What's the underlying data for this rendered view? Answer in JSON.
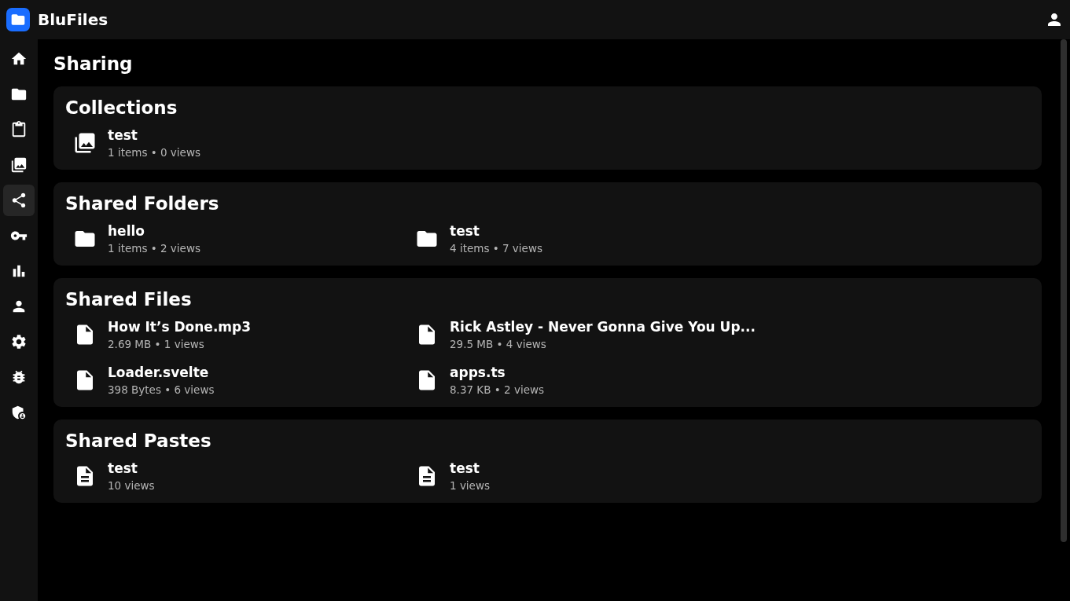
{
  "app": {
    "name": "BluFiles"
  },
  "sidebar": {
    "items": [
      {
        "kind": "home",
        "selected": false
      },
      {
        "kind": "folder",
        "selected": false
      },
      {
        "kind": "clipboard",
        "selected": false
      },
      {
        "kind": "gallery",
        "selected": false
      },
      {
        "kind": "share",
        "selected": true
      },
      {
        "kind": "key",
        "selected": false
      },
      {
        "kind": "chart",
        "selected": false
      },
      {
        "kind": "user",
        "selected": false
      },
      {
        "kind": "settings",
        "selected": false
      },
      {
        "kind": "bug",
        "selected": false
      },
      {
        "kind": "admin",
        "selected": false
      }
    ]
  },
  "page": {
    "title": "Sharing"
  },
  "sections": [
    {
      "title": "Collections",
      "kind": "collection",
      "items": [
        {
          "name": "test",
          "meta": "1 items • 0 views"
        }
      ]
    },
    {
      "title": "Shared Folders",
      "kind": "folder",
      "items": [
        {
          "name": "hello",
          "meta": "1 items • 2 views"
        },
        {
          "name": "test",
          "meta": "4 items • 7 views"
        }
      ]
    },
    {
      "title": "Shared Files",
      "kind": "file",
      "items": [
        {
          "name": "How It’s Done.mp3",
          "meta": "2.69 MB • 1 views"
        },
        {
          "name": "Rick Astley - Never Gonna Give You Up...",
          "meta": "29.5 MB • 4 views"
        },
        {
          "name": "Loader.svelte",
          "meta": "398 Bytes • 6 views"
        },
        {
          "name": "apps.ts",
          "meta": "8.37 KB • 2 views"
        }
      ]
    },
    {
      "title": "Shared Pastes",
      "kind": "paste",
      "items": [
        {
          "name": "test",
          "meta": "10 views"
        },
        {
          "name": "test",
          "meta": "1 views"
        }
      ]
    }
  ]
}
